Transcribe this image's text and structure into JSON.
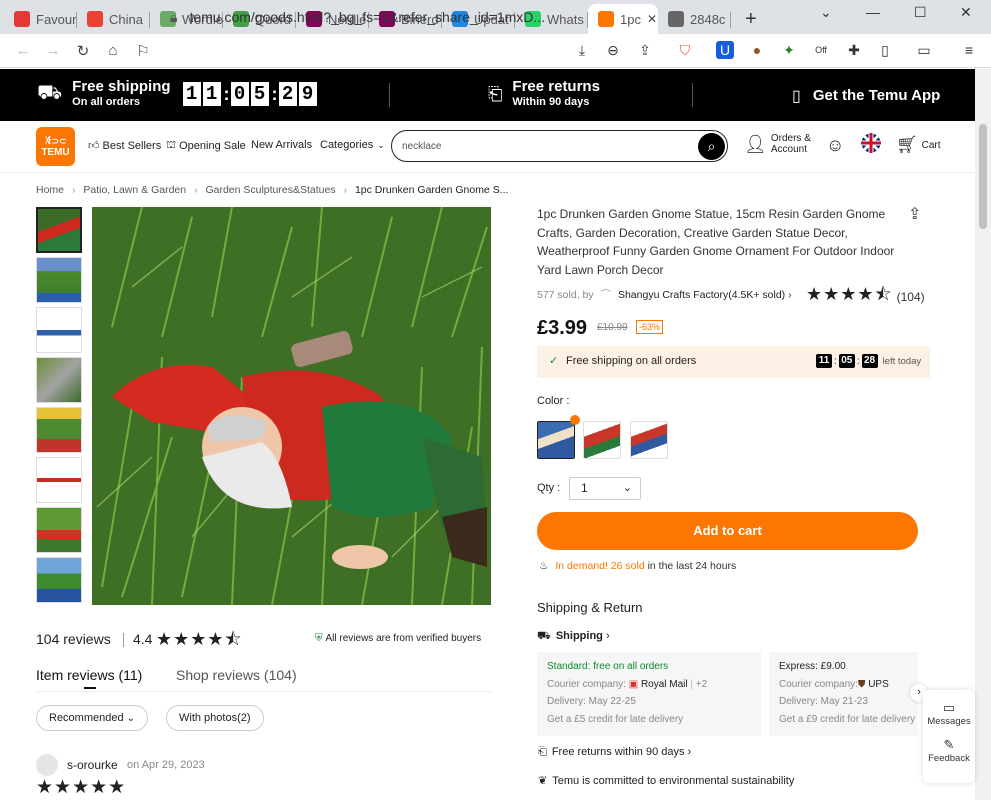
{
  "browser": {
    "tabs": [
      {
        "label": "Favour",
        "icon": "heart-icon",
        "color": "#e53935"
      },
      {
        "label": "China",
        "icon": "gmail-icon",
        "color": "#ea4335"
      },
      {
        "label": "Wordle",
        "icon": "grid-icon",
        "color": "#6aaa64"
      },
      {
        "label": "Quord",
        "icon": "quordle-icon",
        "color": "#43a047"
      },
      {
        "label": "Nerdle",
        "icon": "nerdle-icon",
        "color": "#820458"
      },
      {
        "label": "Binerd",
        "icon": "binerdle-icon",
        "color": "#820458"
      },
      {
        "label": "Updat",
        "icon": "update-icon",
        "color": "#1e88e5"
      },
      {
        "label": "Whats",
        "icon": "whatsapp-icon",
        "color": "#25d366"
      },
      {
        "label": "1pc",
        "icon": "temu-icon",
        "color": "#fb7701"
      },
      {
        "label": "2848c",
        "icon": "globe-icon",
        "color": "#666666"
      }
    ],
    "url": "temu.com/goods.html?_bg_fs=1&refer_share_id=1mxD..."
  },
  "promo": {
    "free_shipping_title": "Free shipping",
    "free_shipping_sub": "On all orders",
    "timer": [
      "1",
      "1",
      "0",
      "5",
      "2",
      "9"
    ],
    "free_returns_title": "Free returns",
    "free_returns_sub": "Within 90 days",
    "app_label": "Get the Temu App"
  },
  "header": {
    "logo_line1": "ꇨ⊃⊂",
    "logo_line2": "TEMU",
    "nav": [
      "Best Sellers",
      "Opening Sale",
      "New Arrivals",
      "Categories"
    ],
    "search_value": "necklace",
    "account_line1": "Orders &",
    "account_line2": "Account",
    "cart": "Cart"
  },
  "breadcrumb": {
    "items": [
      "Home",
      "Patio, Lawn & Garden",
      "Garden Sculptures&Statues",
      "1pc Drunken Garden Gnome S..."
    ]
  },
  "product": {
    "title": "1pc Drunken Garden Gnome Statue, 15cm Resin Garden Gnome Crafts, Garden Decoration, Creative Garden Statue Decor, Weatherproof Funny Garden Gnome Ornament For Outdoor Indoor Yard Lawn Porch Decor",
    "sold": "577 sold, by",
    "shop": "Shangyu Crafts Factory(4.5K+ sold)",
    "rating_stars": 4.5,
    "rating_count": "(104)",
    "price": "£3.99",
    "old_price": "£10.99",
    "discount": "-63%",
    "ship_notice": "Free shipping on all orders",
    "countdown": [
      "11",
      "05",
      "28"
    ],
    "left_today": "left today",
    "color_label": "Color :",
    "qty_label": "Qty :",
    "qty_value": "1",
    "add_to_cart": "Add to cart",
    "demand_highlight": "In demand! 26 sold",
    "demand_rest": "in the last 24 hours"
  },
  "shipping": {
    "heading": "Shipping & Return",
    "shipping_link": "Shipping",
    "standard": {
      "title": "Standard: free on all orders",
      "courier_label": "Courier company:",
      "courier": "Royal Mail",
      "extra": "+2",
      "delivery": "Delivery: May 22-25",
      "credit": "Get a £5 credit for late delivery"
    },
    "express": {
      "title": "Express: £9.00",
      "courier_label": "Courier company:",
      "courier": "UPS",
      "delivery": "Delivery: May 21-23",
      "credit": "Get a £9 credit for late delivery"
    },
    "returns": "Free returns within 90 days",
    "sustain": "Temu is committed to environmental sustainability"
  },
  "reviews": {
    "count": "104 reviews",
    "rating": "4.4",
    "verified": "All reviews are from verified buyers",
    "tab_item": "Item reviews (11)",
    "tab_shop": "Shop reviews (104)",
    "filter_recommended": "Recommended",
    "filter_photos": "With photos(2)",
    "reviewer": "s-orourke",
    "review_date": "on Apr 29, 2023"
  },
  "floating": {
    "messages": "Messages",
    "feedback": "Feedback"
  },
  "colors": {
    "brand": "#fb7701",
    "promo_bg": "#000000",
    "ship_bg": "#fdf0e4",
    "verified_green": "#0a8a2e"
  }
}
